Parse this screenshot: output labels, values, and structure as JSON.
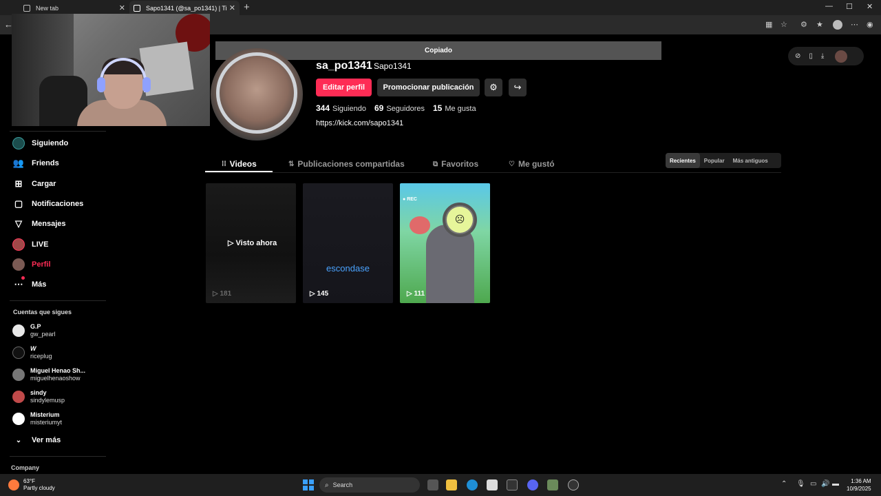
{
  "browser": {
    "tabs": [
      {
        "title": "New tab"
      },
      {
        "title": "Sapo1341 (@sa_po1341) | TikTok"
      }
    ],
    "new_tab_symbol": "+",
    "window_controls": [
      "—",
      "☐",
      "✕"
    ]
  },
  "toast": {
    "text": "Copiado"
  },
  "sidebar": {
    "items": [
      {
        "label": "Siguiendo",
        "icon": "following-avatar-icon"
      },
      {
        "label": "Friends",
        "icon": "friends-icon"
      },
      {
        "label": "Cargar",
        "icon": "upload-icon"
      },
      {
        "label": "Notificaciones",
        "icon": "notifications-icon"
      },
      {
        "label": "Mensajes",
        "icon": "messages-icon"
      },
      {
        "label": "LIVE",
        "icon": "live-icon"
      },
      {
        "label": "Perfil",
        "icon": "profile-icon"
      },
      {
        "label": "Más",
        "icon": "more-icon"
      }
    ],
    "following_title": "Cuentas que sigues",
    "following": [
      {
        "name": "G.P",
        "handle": "gw_pearl"
      },
      {
        "name": "W",
        "handle": "riceplug"
      },
      {
        "name": "Miguel Henao Sh...",
        "handle": "miguelhenaoshow"
      },
      {
        "name": "sindy",
        "handle": "sindylemusp"
      },
      {
        "name": "Misterium",
        "handle": "misteriumyt"
      }
    ],
    "see_more": "Ver más",
    "company": "Company"
  },
  "profile": {
    "username": "sa_po1341",
    "nickname": "Sapo1341",
    "edit_button": "Editar perfil",
    "promote_button": "Promocionar publicación",
    "stats": [
      {
        "value": "344",
        "label": "Siguiendo"
      },
      {
        "value": "69",
        "label": "Seguidores"
      },
      {
        "value": "15",
        "label": "Me gusta"
      }
    ],
    "link": "https://kick.com/sapo1341"
  },
  "tabs": [
    {
      "label": "Videos",
      "active": true
    },
    {
      "label": "Publicaciones compartidas"
    },
    {
      "label": "Favoritos"
    },
    {
      "label": "Me gustó"
    }
  ],
  "sort": [
    "Recientes",
    "Popular",
    "Más antiguos"
  ],
  "videos": [
    {
      "views": "181",
      "overlay": "Visto ahora"
    },
    {
      "views": "145",
      "text": "escondase"
    },
    {
      "views": "111",
      "rec": "REC"
    }
  ],
  "taskbar": {
    "temp": "63°F",
    "weather": "Partly cloudy",
    "search": "Search",
    "time": "1:36 AM",
    "date": "10/9/2025"
  },
  "colors": {
    "accent": "#fe2c55",
    "background": "#000000",
    "link_blue": "#4aa3ff"
  }
}
